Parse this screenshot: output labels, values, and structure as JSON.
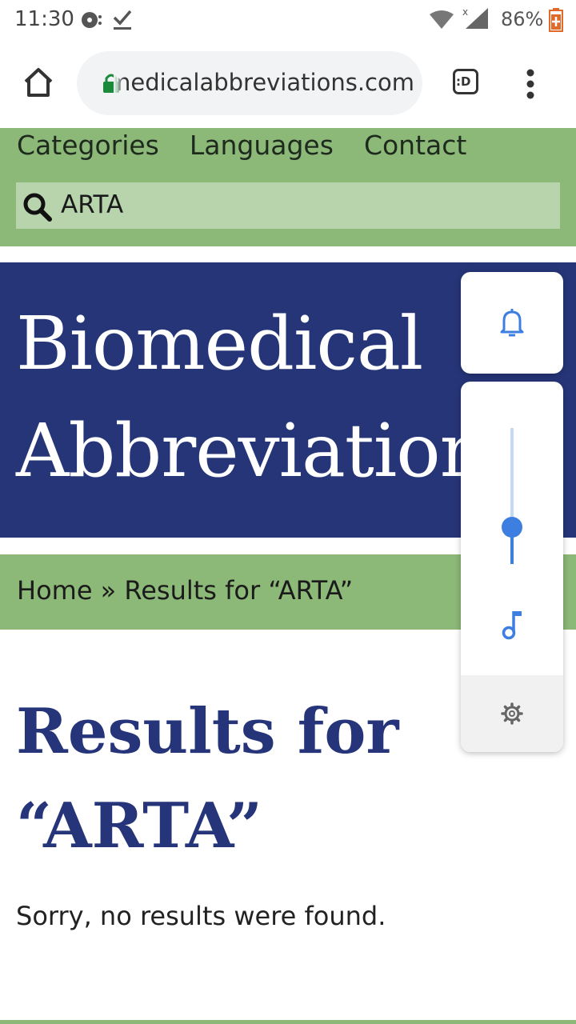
{
  "status_bar": {
    "time": "11:30",
    "battery": "86%",
    "icons": [
      "media-icon",
      "download-done-icon",
      "wifi-icon",
      "signal-icon",
      "battery-icon"
    ]
  },
  "browser": {
    "url": "medicalabbreviations.com",
    "tab_switcher": ":D",
    "icons": [
      "home-icon",
      "lock-icon",
      "more-vert-icon"
    ]
  },
  "site_nav": {
    "items": [
      "Categories",
      "Languages",
      "Contact"
    ],
    "search_value": "ARTA"
  },
  "hero": {
    "line1": "Biomedical",
    "line2": "Abbreviations"
  },
  "breadcrumb": {
    "text": "Home » Results for “ARTA”"
  },
  "results": {
    "title": "Results for “ARTA”",
    "message": "Sorry, no results were found."
  },
  "volume_panel": {
    "level": 0.27,
    "icons": [
      "bell-icon",
      "music-note-icon",
      "gear-icon"
    ],
    "accent_color": "#3d7fe0"
  },
  "colors": {
    "nav_green": "#8cb878",
    "hero_blue": "#263578",
    "search_bg": "#b7d4ac"
  }
}
